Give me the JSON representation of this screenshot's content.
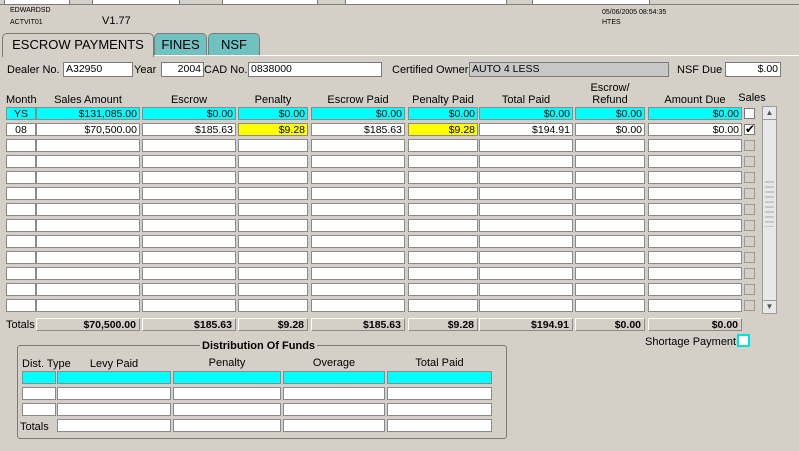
{
  "header": {
    "user": "EDWARDSD",
    "program": "ACTVIT01",
    "version": "V1.77",
    "datetime": "05/06/2005 08:54:35",
    "system": "HTES"
  },
  "tabs": [
    {
      "label": "ESCROW PAYMENTS"
    },
    {
      "label": "FINES"
    },
    {
      "label": "NSF"
    }
  ],
  "form": {
    "dealer_label": "Dealer No.",
    "dealer_value": "A32950",
    "year_label": "Year",
    "year_value": "2004",
    "cad_label": "CAD No.",
    "cad_value": "0838000",
    "owner_label": "Certified Owner",
    "owner_value": "AUTO 4 LESS",
    "nsf_label": "NSF Due",
    "nsf_value": "$.00"
  },
  "grid": {
    "headers": {
      "month": "Month",
      "sales": "Sales Amount",
      "escrow": "Escrow",
      "penalty": "Penalty",
      "escrow_paid": "Escrow Paid",
      "penalty_paid": "Penalty Paid",
      "total_paid": "Total Paid",
      "escrow_refund_1": "Escrow/",
      "escrow_refund_2": "Refund",
      "amount_due": "Amount Due",
      "sales_flag": "Sales"
    },
    "rows": [
      {
        "month": "YS",
        "sales": "$131,085.00",
        "escrow": "$0.00",
        "penalty": "$0.00",
        "escrow_paid": "$0.00",
        "penalty_paid": "$0.00",
        "total_paid": "$0.00",
        "refund": "$0.00",
        "amount_due": "$0.00",
        "checked": false
      },
      {
        "month": "08",
        "sales": "$70,500.00",
        "escrow": "$185.63",
        "penalty": "$9.28",
        "escrow_paid": "$185.63",
        "penalty_paid": "$9.28",
        "total_paid": "$194.91",
        "refund": "$0.00",
        "amount_due": "$0.00",
        "checked": true
      }
    ],
    "totals_label": "Totals",
    "totals": {
      "sales": "$70,500.00",
      "escrow": "$185.63",
      "penalty": "$9.28",
      "escrow_paid": "$185.63",
      "penalty_paid": "$9.28",
      "total_paid": "$194.91",
      "refund": "$0.00",
      "amount_due": "$0.00"
    }
  },
  "shortage_label": "Shortage Payment",
  "distribution": {
    "title": "Distribution Of Funds",
    "headers": {
      "dist_type": "Dist. Type",
      "levy_paid": "Levy Paid",
      "penalty": "Penalty",
      "overage": "Overage",
      "total_paid": "Total Paid"
    },
    "totals_label": "Totals"
  },
  "colors": {
    "background": "#d4d0c8",
    "tab_inactive": "#6fc2c0",
    "highlight_cyan": "#00ffff",
    "highlight_yellow": "#ffff00"
  }
}
